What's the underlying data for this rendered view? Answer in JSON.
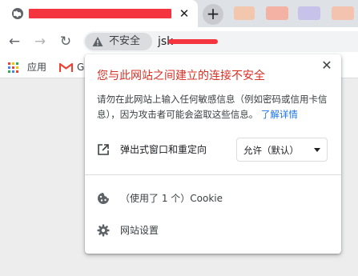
{
  "browser": {
    "tab_close_glyph": "✕",
    "new_tab_glyph": "+",
    "redaction_color": "#f4353f",
    "blurred_tab_colors": [
      "#f3c7ae",
      "#f3b2a3",
      "#c7c2ea",
      "#f4c3b0"
    ]
  },
  "toolbar": {
    "back_glyph": "←",
    "forward_glyph": "→",
    "reload_glyph": "↻",
    "security_chip_label": "不安全",
    "url_visible": "jsk"
  },
  "bookmarks": {
    "apps_label": "应用",
    "gmail_label": "G"
  },
  "popup": {
    "close_glyph": "✕",
    "title": "您与此网站之间建立的连接不安全",
    "description": "请勿在此网站上输入任何敏感信息（例如密码或信用卡信息），因为攻击者可能会盗取这些信息。",
    "learn_more": "了解详情",
    "permission": {
      "label": "弹出式窗口和重定向",
      "value": "允许（默认）"
    },
    "cookies_label": "（使用了 1 个）Cookie",
    "site_settings_label": "网站设置"
  },
  "colors": {
    "warning_title": "#d93025",
    "link": "#1a73e8"
  }
}
